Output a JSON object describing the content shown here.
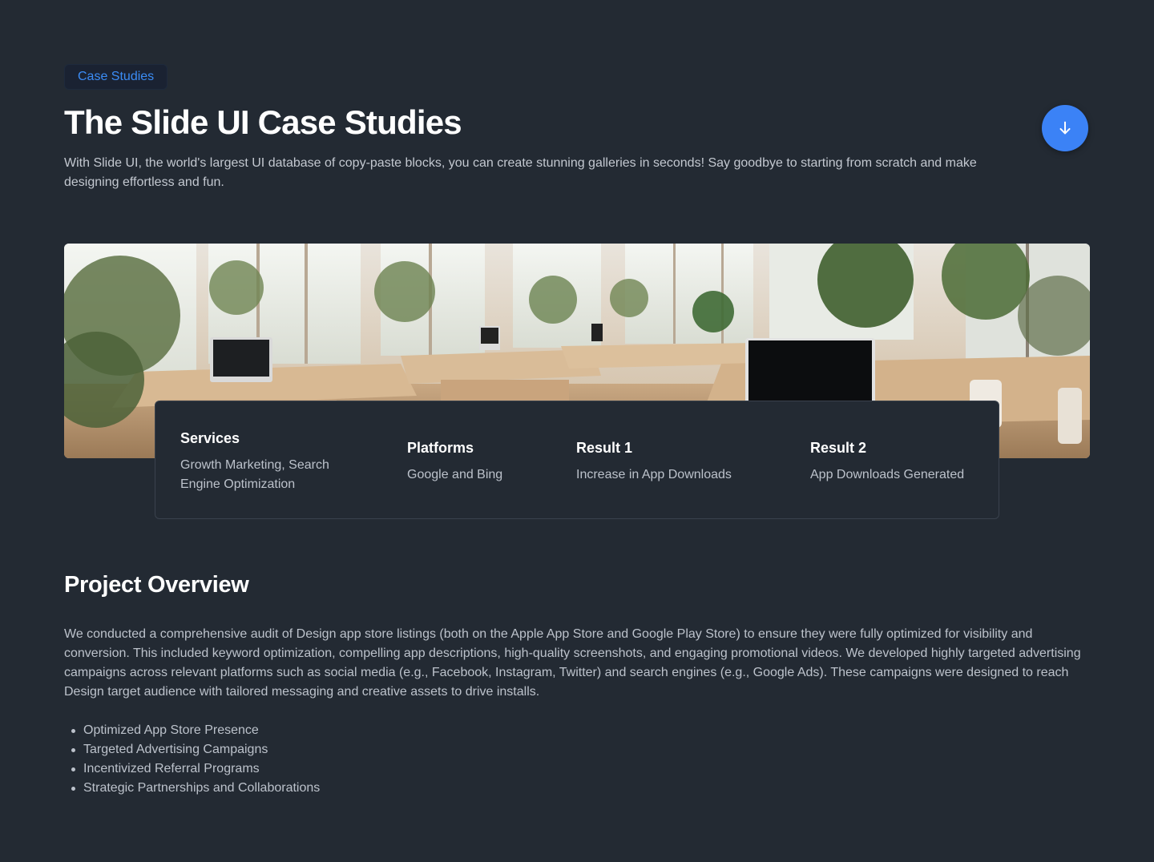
{
  "header": {
    "badge": "Case Studies",
    "title": "The Slide UI Case Studies",
    "subtitle": "With Slide UI, the world's largest UI database of copy-paste blocks, you can create stunning galleries in seconds! Say goodbye to starting from scratch and make designing effortless and fun.",
    "scroll_icon": "arrow-down-icon"
  },
  "hero": {
    "image_subject": "bright modern office interior with desks, computers and plants"
  },
  "info": [
    {
      "label": "Services",
      "value": "Growth Marketing, Search Engine Optimization"
    },
    {
      "label": "Platforms",
      "value": "Google and Bing"
    },
    {
      "label": "Result 1",
      "value": "Increase in App Downloads"
    },
    {
      "label": "Result 2",
      "value": "App Downloads Generated"
    }
  ],
  "overview": {
    "title": "Project Overview",
    "body": "We conducted a comprehensive audit of Design app store listings (both on the Apple App Store and Google Play Store) to ensure they were fully optimized for visibility and conversion. This included keyword optimization, compelling app descriptions, high-quality screenshots, and engaging promotional videos. We developed highly targeted advertising campaigns across relevant platforms such as social media (e.g., Facebook, Instagram, Twitter) and search engines (e.g., Google Ads). These campaigns were designed to reach Design target audience with tailored messaging and creative assets to drive installs.",
    "bullets": [
      "Optimized App Store Presence",
      "Targeted Advertising Campaigns",
      "Incentivized Referral Programs",
      "Strategic Partnerships and Collaborations"
    ]
  },
  "colors": {
    "background": "#232a33",
    "accent": "#3b82f6",
    "badge_text": "#3b8cf5",
    "body_text": "#bcc2cb"
  }
}
